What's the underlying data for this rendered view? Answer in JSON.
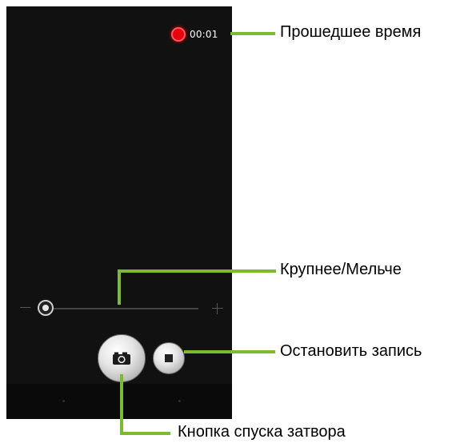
{
  "recording": {
    "elapsed_time": "00:01",
    "indicator_color": "#e8000e"
  },
  "zoom": {
    "level": 0
  },
  "controls": {
    "shutter_icon": "camera-icon",
    "stop_icon": "stop-icon"
  },
  "callouts": {
    "elapsed_time": "Прошедшее время",
    "zoom": "Крупнее/Мельче",
    "stop": "Остановить запись",
    "shutter": "Кнопка спуска затвора"
  },
  "colors": {
    "leader_line": "#7cbb2d",
    "screen_background": "#111111"
  }
}
